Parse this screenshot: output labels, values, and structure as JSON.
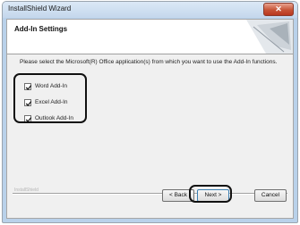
{
  "window": {
    "title": "InstallShield Wizard",
    "close_glyph": "✕"
  },
  "header": {
    "title": "Add-In Settings"
  },
  "main": {
    "description": "Please select the Microsoft(R) Office application(s) from which you want to use the Add-In functions.",
    "checkboxes": [
      {
        "label": "Word Add-In",
        "checked": true
      },
      {
        "label": "Excel Add-In",
        "checked": true
      },
      {
        "label": "Outlook Add-In",
        "checked": true
      }
    ]
  },
  "footer": {
    "watermark": "InstallShield",
    "back_label": "< Back",
    "next_label": "Next >",
    "cancel_label": "Cancel"
  },
  "colors": {
    "titlebar": "#c4d7ec",
    "client_bg": "#f0f0f0",
    "close_button": "#c75336",
    "highlight_ring": "#111111"
  }
}
